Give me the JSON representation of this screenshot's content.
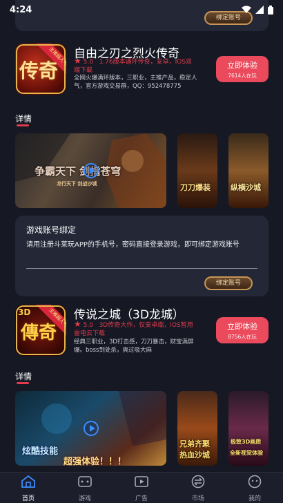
{
  "status_bar": {
    "time": "4:24"
  },
  "top_card": {
    "bind_button": "绑定账号"
  },
  "game1": {
    "icon_text": "传奇",
    "icon_ribbon": "主推超人气",
    "name": "自由之刃之烈火传奇",
    "rating": "5.0",
    "tags": "1.76版本遇环传奇，安卓，IOS双端下载",
    "description": "全网火爆满环版本，三职业，主推产品，稳定人气，官方游戏交易群，QQ：952478775",
    "try_label": "立即体验",
    "try_count": "7614人在玩",
    "section_title": "详情",
    "video_caption": "争霸天下 剑指苍穹",
    "video_subcaption": "龙行天下 剑战沙城",
    "shot2_caption": "刀刀爆装",
    "shot3_caption": "纵横沙城"
  },
  "bind_card": {
    "title": "游戏账号绑定",
    "description": "请用注册斗莱玩APP的手机号，密码直接登录游戏，即可绑定游戏账号",
    "button": "绑定账号"
  },
  "game2": {
    "icon_text": "傳奇",
    "icon_badge": "3D",
    "icon_ribbon": "主推超人气",
    "name": "传说之城（3D龙城）",
    "rating": "5.0",
    "tags": "3D传奇大作，仅安卓端，IOS暂用雷电云下载",
    "description": "经典三职业，3D打击感，刀刀暴击，财宝满屏爆。boss到处杀，爽过吸大麻",
    "try_label": "立即体验",
    "try_count": "8756人在玩",
    "section_title": "详情",
    "video_caption": "炫酷技能",
    "video_caption2": "超强体验！！！",
    "shot2_caption": "兄弟齐聚",
    "shot2_caption2": "热血沙城",
    "shot3_caption": "极致3D画质",
    "shot3_caption2": "全新视觉体验"
  },
  "tabbar": {
    "items": [
      {
        "label": "首页",
        "icon": "home-icon",
        "active": true
      },
      {
        "label": "游戏",
        "icon": "gamepad-icon",
        "active": false
      },
      {
        "label": "广告",
        "icon": "video-icon",
        "active": false
      },
      {
        "label": "市场",
        "icon": "exchange-icon",
        "active": false
      },
      {
        "label": "我的",
        "icon": "profile-icon",
        "active": false
      }
    ]
  },
  "colors": {
    "background": "#161824",
    "card": "#242736",
    "accent_red": "#ea4a5b",
    "play_blue": "#3a8cff",
    "gold": "#c89656"
  }
}
